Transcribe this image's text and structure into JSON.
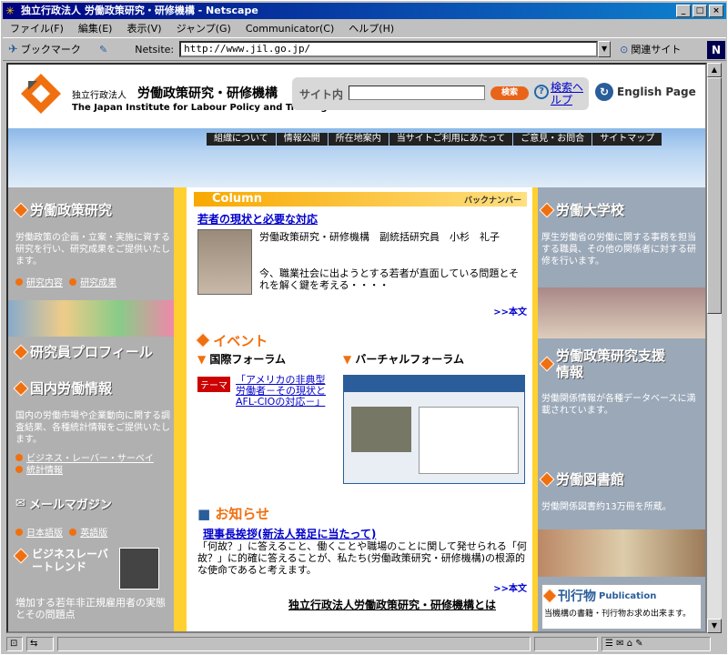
{
  "window": {
    "title": "独立行政法人 労働政策研究・研修機構 - Netscape",
    "minimize": "_",
    "maximize": "□",
    "close": "×"
  },
  "menu": [
    "ファイル(F)",
    "編集(E)",
    "表示(V)",
    "ジャンプ(G)",
    "Communicator(C)",
    "ヘルプ(H)"
  ],
  "toolbar": {
    "bookmark_label": "ブックマーク",
    "netsite_label": "Netsite:",
    "url": "http://www.jil.go.jp/",
    "related_label": "関連サイト"
  },
  "header": {
    "org_prefix": "独立行政法人",
    "org_name_jp": "労働政策研究・研修機構",
    "org_name_en": "The Japan Institute for Labour Policy and Training",
    "search_label": "サイト内",
    "search_button": "検索",
    "search_help": "検索ヘルプ",
    "english_page": "English Page"
  },
  "nav": [
    "組織について",
    "情報公開",
    "所在地案内",
    "当サイトご利用にあたって",
    "ご意見・お問合",
    "サイトマップ"
  ],
  "left": {
    "research": {
      "title": "労働政策研究",
      "text": "労働政策の企画・立案・実施に資する研究を行い、研究成果をご提供いたします。",
      "link1": "研究内容",
      "link2": "研究成果"
    },
    "profile": "研究員プロフィール",
    "domestic": {
      "title": "国内労働情報",
      "text": "国内の労働市場や企業動向に関する調査結果、各種統計情報をご提供いたします。",
      "link1": "ビジネス・レーバー・サーベイ",
      "link2": "統計情報"
    },
    "mail": {
      "title": "メールマガジン",
      "ja": "日本語版",
      "en": "英語版"
    },
    "blt": {
      "title": "ビジネスレーバートレンド",
      "text": "増加する若年非正規雇用者の実態とその問題点"
    }
  },
  "center": {
    "column_label": "Column",
    "backnumber": "バックナンバー",
    "column_title": "若者の現状と必要な対応",
    "author": "労働政策研究・研修機構　副統括研究員　小杉　礼子",
    "excerpt": "今、職業社会に出ようとする若者が直面している問題とそれを解く鍵を考える・・・・",
    "more": ">>本文",
    "event_label": "イベント",
    "forum_intl": "国際フォーラム",
    "forum_virtual": "バーチャルフォーラム",
    "theme_tag": "テーマ",
    "theme_link": "「アメリカの非典型労働者－その現状とAFL-CIOの対応－」",
    "news_label": "お知らせ",
    "news_link": "理事長挨拶(新法人発足に当たって)",
    "news_text": "「何故？」に答えること、働くことや職場のことに関して発せられる「何故？」に的確に答えることが、私たち(労働政策研究・研修機構)の根源的な使命であると考えます。",
    "news_more": ">>本文",
    "about": "独立行政法人労働政策研究・研修機構とは"
  },
  "right": {
    "college": {
      "title": "労働大学校",
      "text": "厚生労働省の労働に関する事務を担当する職員、その他の関係者に対する研修を行います。"
    },
    "support": {
      "title": "労働政策研究支援情報",
      "text": "労働関係情報が各種データベースに満載されています。"
    },
    "library": {
      "title": "労働図書館",
      "text": "労働関係図書約13万冊を所蔵。"
    },
    "pub": {
      "title": "刊行物",
      "title_en": "Publication",
      "text": "当機構の書籍・刊行物お求め出来ます。"
    }
  }
}
